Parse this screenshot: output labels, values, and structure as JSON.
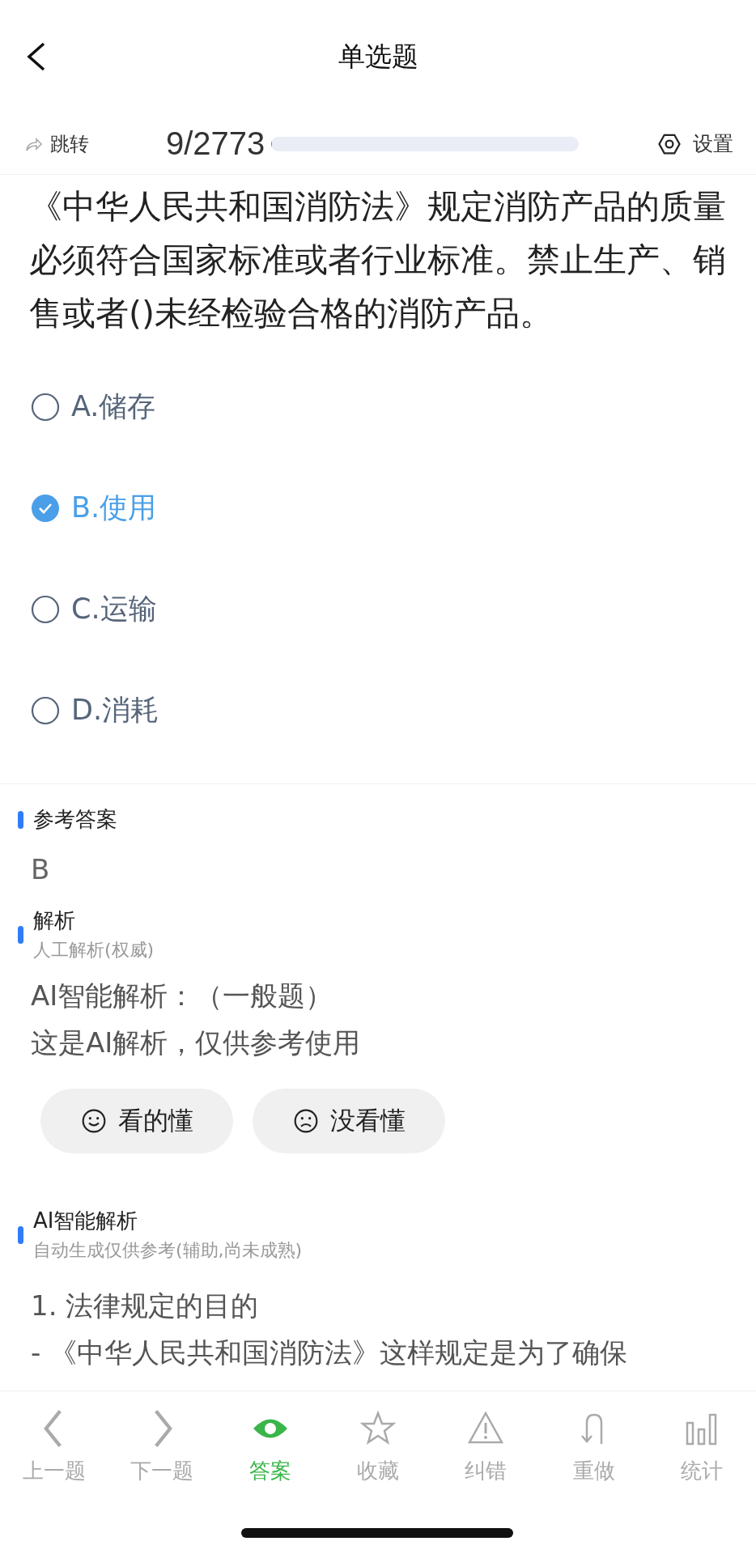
{
  "header": {
    "title": "单选题"
  },
  "toolbar": {
    "jump": "跳转",
    "progress_text": "9/2773",
    "progress": {
      "level": 0.003
    },
    "settings": "设置"
  },
  "question": {
    "text": "《中华人民共和国消防法》规定消防产品的质量必须符合国家标准或者行业标准。禁止生产、销售或者()未经检验合格的消防产品。",
    "options": [
      {
        "label": "A.储存",
        "selected": false
      },
      {
        "label": "B.使用",
        "selected": true
      },
      {
        "label": "C.运输",
        "selected": false
      },
      {
        "label": "D.消耗",
        "selected": false
      }
    ]
  },
  "answer": {
    "heading": "参考答案",
    "value": "B"
  },
  "analysis": {
    "heading": "解析",
    "subtitle": "人工解析(权威)",
    "lines": [
      "AI智能解析：（一般题）",
      "这是AI解析，仅供参考使用"
    ],
    "buttons": [
      {
        "kind": "smile",
        "label": "看的懂"
      },
      {
        "kind": "frown",
        "label": "没看懂"
      }
    ]
  },
  "ai_analysis": {
    "heading": "AI智能解析",
    "subtitle": "自动生成仅供参考(辅助,尚未成熟)",
    "lines": [
      "1. 法律规定的目的",
      "- 《中华人民共和国消防法》这样规定是为了确保"
    ]
  },
  "bottom_nav": [
    {
      "kind": "prev",
      "label": "上一题",
      "selected": false
    },
    {
      "kind": "next",
      "label": "下一题",
      "selected": false
    },
    {
      "kind": "eye",
      "label": "答案",
      "selected": true
    },
    {
      "kind": "star",
      "label": "收藏",
      "selected": false
    },
    {
      "kind": "warning",
      "label": "纠错",
      "selected": false
    },
    {
      "kind": "redo",
      "label": "重做",
      "selected": false
    },
    {
      "kind": "stats",
      "label": "统计",
      "selected": false
    }
  ]
}
